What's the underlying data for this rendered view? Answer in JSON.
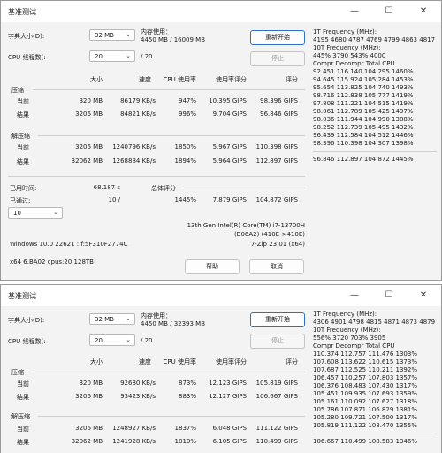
{
  "w1": {
    "title": "基准测试",
    "dict_label": "字典大小(D):",
    "dict_value": "32 MB",
    "threads_label": "CPU 线程数(:",
    "threads_value": "20",
    "threads_total": "/ 20",
    "mem_label": "内存使用：",
    "mem_value": "4450 MB / 16009 MB",
    "restart": "重新开始",
    "stop": "停止",
    "headers": [
      "大小",
      "速度",
      "CPU 使用率",
      "使用率评分",
      "评分"
    ],
    "compress_label": "压缩",
    "decompress_label": "解压缩",
    "current_label": "当前",
    "result_label": "结果",
    "compress_current": [
      "320 MB",
      "86179 KB/s",
      "947%",
      "10.395 GIPS",
      "98.396 GIPS"
    ],
    "compress_result": [
      "3206 MB",
      "84821 KB/s",
      "996%",
      "9.704 GIPS",
      "96.846 GIPS"
    ],
    "decompress_current": [
      "3206 MB",
      "1240796 KB/s",
      "1850%",
      "5.967 GIPS",
      "110.398 GIPS"
    ],
    "decompress_result": [
      "32062 MB",
      "1268884 KB/s",
      "1894%",
      "5.964 GIPS",
      "112.897 GIPS"
    ],
    "elapsed_label": "已用时间:",
    "elapsed_value": "68.187 s",
    "passed_label": "已通过:",
    "passed_value": "10 /",
    "passes_combo": "10",
    "total_label": "总体评分",
    "total": [
      "1445%",
      "7.879 GIPS",
      "104.872 GIPS"
    ],
    "cpu_line1": "13th Gen Intel(R) Core(TM) i7-13700H",
    "cpu_line2": "(B06A2) (410E->410E)",
    "os_line": "Windows 10.0 22621 : f:5F310F2774C",
    "zip_ver": "7-Zip 23.01 (x64)",
    "arch_line": "x64 6.BA02 cpus:20 128TB",
    "help": "帮助",
    "cancel": "取消",
    "side": {
      "f1_title": "1T Frequency (MHz):",
      "f1_values": "4195 4680 4787 4769 4799 4863 4817",
      "f10_title": "10T Frequency (MHz):",
      "f10_values": "445% 3790 543% 4000",
      "header": "Compr Decompr Total   CPU",
      "rows": [
        "92.451  116.140  104.295  1460%",
        "94.645  115.924  105.284  1453%",
        "95.654  113.825  104.740  1493%",
        "98.716  112.838  105.777  1419%",
        "97.808  111.221  104.515  1419%",
        "98.061  112.789  105.425  1497%",
        "98.036  111.944  104.990  1388%",
        "98.252  112.739  105.495  1432%",
        "96.439  112.584  104.512  1446%",
        "98.396  110.398  104.307  1398%"
      ],
      "summary": "96.846  112.897  104.872  1445%"
    }
  },
  "w2": {
    "title": "基准测试",
    "dict_label": "字典大小(D):",
    "dict_value": "32 MB",
    "threads_label": "CPU 线程数(:",
    "threads_value": "20",
    "threads_total": "/ 20",
    "mem_label": "内存使用：",
    "mem_value": "4450 MB / 32393 MB",
    "restart": "重新开始",
    "stop": "停止",
    "headers": [
      "大小",
      "速度",
      "CPU 使用率",
      "使用率评分",
      "评分"
    ],
    "compress_label": "压缩",
    "decompress_label": "解压缩",
    "current_label": "当前",
    "result_label": "结果",
    "compress_current": [
      "320 MB",
      "92680 KB/s",
      "873%",
      "12.123 GIPS",
      "105.819 GIPS"
    ],
    "compress_result": [
      "3206 MB",
      "93423 KB/s",
      "883%",
      "12.127 GIPS",
      "106.667 GIPS"
    ],
    "decompress_current": [
      "3206 MB",
      "1248927 KB/s",
      "1837%",
      "6.048 GIPS",
      "111.122 GIPS"
    ],
    "decompress_result": [
      "32062 MB",
      "1241928 KB/s",
      "1810%",
      "6.105 GIPS",
      "110.499 GIPS"
    ],
    "side": {
      "f1_title": "1T Frequency (MHz):",
      "f1_values": "4306 4901 4798 4815 4871 4873 4879",
      "f10_title": "10T Frequency (MHz):",
      "f10_values": "556% 3720 703% 3905",
      "header": "Compr Decompr Total   CPU",
      "rows": [
        "110.374  112.757  111.476  1303%",
        "107.608  113.622  110.615  1373%",
        "107.687  112.525  110.211  1392%",
        "106.457  110.257  107.803  1357%",
        "106.376  108.483  107.430  1317%",
        "105.451  109.935  107.693  1359%",
        "105.161  110.092  107.627  1318%",
        "105.786  107.871  106.829  1381%",
        "105.280  109.721  107.500  1317%",
        "105.819  111.122  108.470  1355%"
      ],
      "summary": "106.667  110.499  108.583  1346%"
    }
  }
}
